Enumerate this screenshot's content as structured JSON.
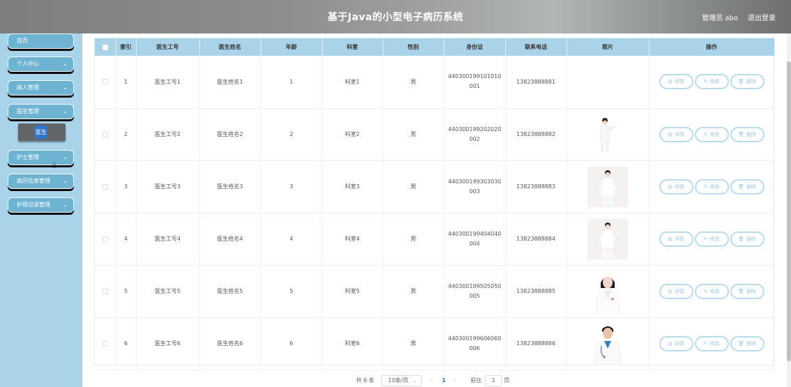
{
  "header": {
    "title": "基于Java的小型电子病历系统",
    "user": "管理员 abo",
    "logout": "退出登录"
  },
  "sidebar": {
    "items": [
      {
        "label": "首页",
        "has_chevron": false
      },
      {
        "label": "个人中心",
        "has_chevron": true
      },
      {
        "label": "病人管理",
        "has_chevron": true
      },
      {
        "label": "医生管理",
        "has_chevron": true
      },
      {
        "label": "护士管理",
        "has_chevron": true
      },
      {
        "label": "病历信息管理",
        "has_chevron": true
      },
      {
        "label": "护理记录管理",
        "has_chevron": true
      }
    ],
    "submenu_item": "医生",
    "chevron": "⌄"
  },
  "table": {
    "headers": [
      "索引",
      "医生工号",
      "医生姓名",
      "年龄",
      "科室",
      "性别",
      "身份证",
      "联系电话",
      "照片",
      "操作"
    ],
    "rows": [
      {
        "index": "1",
        "work_no": "医生工号1",
        "name": "医生姓名1",
        "age": "1",
        "dept": "科室1",
        "gender": "男",
        "id_line1": "440300199101010",
        "id_line2": "001",
        "phone": "13823888881",
        "photo": "none"
      },
      {
        "index": "2",
        "work_no": "医生工号2",
        "name": "医生姓名2",
        "age": "2",
        "dept": "科室2",
        "gender": "男",
        "id_line1": "440300199202020",
        "id_line2": "002",
        "phone": "13823888882",
        "photo": "nurse-gesture"
      },
      {
        "index": "3",
        "work_no": "医生工号3",
        "name": "医生姓名3",
        "age": "3",
        "dept": "科室3",
        "gender": "男",
        "id_line1": "440300199303030",
        "id_line2": "003",
        "phone": "13823888883",
        "photo": "nurse-standing"
      },
      {
        "index": "4",
        "work_no": "医生工号4",
        "name": "医生姓名4",
        "age": "4",
        "dept": "科室4",
        "gender": "男",
        "id_line1": "440300199404040",
        "id_line2": "004",
        "phone": "13823888884",
        "photo": "nurse-standing"
      },
      {
        "index": "5",
        "work_no": "医生工号5",
        "name": "医生姓名5",
        "age": "5",
        "dept": "科室5",
        "gender": "男",
        "id_line1": "440300199505050",
        "id_line2": "005",
        "phone": "13823888885",
        "photo": "female-doctor"
      },
      {
        "index": "6",
        "work_no": "医生工号6",
        "name": "医生姓名6",
        "age": "6",
        "dept": "科室6",
        "gender": "男",
        "id_line1": "440300199606060",
        "id_line2": "006",
        "phone": "13823888886",
        "photo": "male-doctor"
      }
    ],
    "actions": {
      "detail": "详情",
      "edit": "修改",
      "delete": "删除",
      "detail_icon": "▤",
      "edit_icon": "✎",
      "delete_icon": "🗑"
    }
  },
  "pagination": {
    "total": "共 6 条",
    "page_size": "10条/页",
    "prev": "‹",
    "current": "1",
    "next": "›",
    "goto_label": "前往",
    "goto_value": "1",
    "page_suffix": "页"
  },
  "colors": {
    "sidebar_bg": "#a9d3e8",
    "menu_button": "#6fb3d3",
    "table_header": "#a9d3e8",
    "action_border": "#b8dcec",
    "submenu_active": "#2e76c9"
  }
}
